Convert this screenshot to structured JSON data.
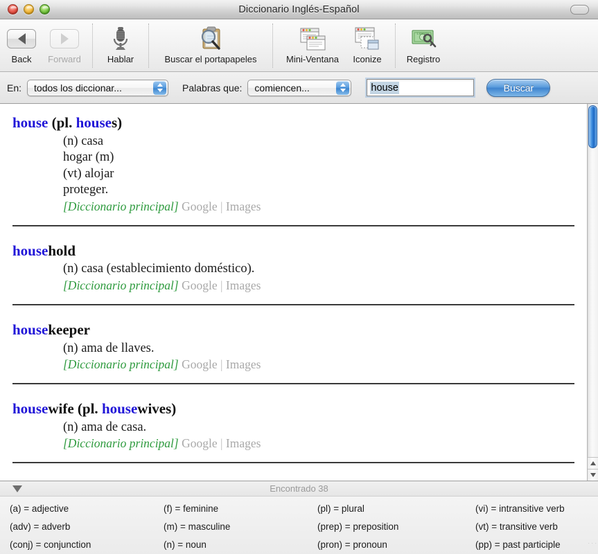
{
  "window": {
    "title": "Diccionario Inglés-Español",
    "traffic_lights": [
      "close",
      "minimize",
      "zoom"
    ],
    "toolbar_toggle": "toolbar-toggle"
  },
  "toolbar": {
    "items": [
      {
        "id": "back",
        "label": "Back",
        "icon": "back-arrow-icon",
        "enabled": true
      },
      {
        "id": "forward",
        "label": "Forward",
        "icon": "forward-arrow-icon",
        "enabled": false
      },
      {
        "id": "hablar",
        "label": "Hablar",
        "icon": "microphone-icon",
        "enabled": true
      },
      {
        "id": "clipboard",
        "label": "Buscar el portapapeles",
        "icon": "clipboard-search-icon",
        "enabled": true
      },
      {
        "id": "mini",
        "label": "Mini-Ventana",
        "icon": "stacked-windows-icon",
        "enabled": true
      },
      {
        "id": "iconize",
        "label": "Iconize",
        "icon": "iconize-windows-icon",
        "enabled": true
      },
      {
        "id": "registro",
        "label": "Registro",
        "icon": "license-key-icon",
        "enabled": true
      }
    ]
  },
  "search": {
    "dictionary_label": "En:",
    "dictionary_value": "todos los diccionar...",
    "match_label": "Palabras que:",
    "match_value": "comiencen...",
    "query_value": "house",
    "query_placeholder": "",
    "submit_label": "Buscar"
  },
  "results": {
    "entries": [
      {
        "headword_parts": [
          {
            "text": "house",
            "highlight": true
          },
          {
            "text": " (pl. ",
            "highlight": false
          },
          {
            "text": "house",
            "highlight": true
          },
          {
            "text": "s)",
            "highlight": false
          }
        ],
        "definitions": [
          "(n) casa",
          "hogar (m)",
          "(vt) alojar",
          "proteger."
        ],
        "source": "[Diccionario principal]",
        "links": [
          "Google",
          "Images"
        ],
        "separator": "|"
      },
      {
        "headword_parts": [
          {
            "text": "house",
            "highlight": true
          },
          {
            "text": "hold",
            "highlight": false
          }
        ],
        "definitions": [
          "(n) casa (establecimiento doméstico)."
        ],
        "source": "[Diccionario principal]",
        "links": [
          "Google",
          "Images"
        ],
        "separator": "|"
      },
      {
        "headword_parts": [
          {
            "text": "house",
            "highlight": true
          },
          {
            "text": "keeper",
            "highlight": false
          }
        ],
        "definitions": [
          "(n) ama de llaves."
        ],
        "source": "[Diccionario principal]",
        "links": [
          "Google",
          "Images"
        ],
        "separator": "|"
      },
      {
        "headword_parts": [
          {
            "text": "house",
            "highlight": true
          },
          {
            "text": "wife (pl. ",
            "highlight": false
          },
          {
            "text": "house",
            "highlight": true
          },
          {
            "text": "wives)",
            "highlight": false
          }
        ],
        "definitions": [
          "(n) ama de casa."
        ],
        "source": "[Diccionario principal]",
        "links": [
          "Google",
          "Images"
        ],
        "separator": "|"
      }
    ]
  },
  "status": {
    "found_text": "Encontrado 38",
    "disclosure_icon": "triangle-down-icon"
  },
  "legend": {
    "entries": [
      "(a) = adjective",
      "(f) = feminine",
      "(pl) = plural",
      "(vi) = intransitive verb",
      "(adv) = adverb",
      "(m) = masculine",
      "(prep) = preposition",
      "(vt) = transitive verb",
      "(conj) = conjunction",
      "(n) = noun",
      "(pron) = pronoun",
      "(pp) = past participle"
    ]
  },
  "colors": {
    "headword_highlight": "#2116d8",
    "source": "#2f9b3f",
    "external_link": "#a9a9a9",
    "accent_blue": "#3f84cf",
    "selection": "#c3d5e4"
  }
}
